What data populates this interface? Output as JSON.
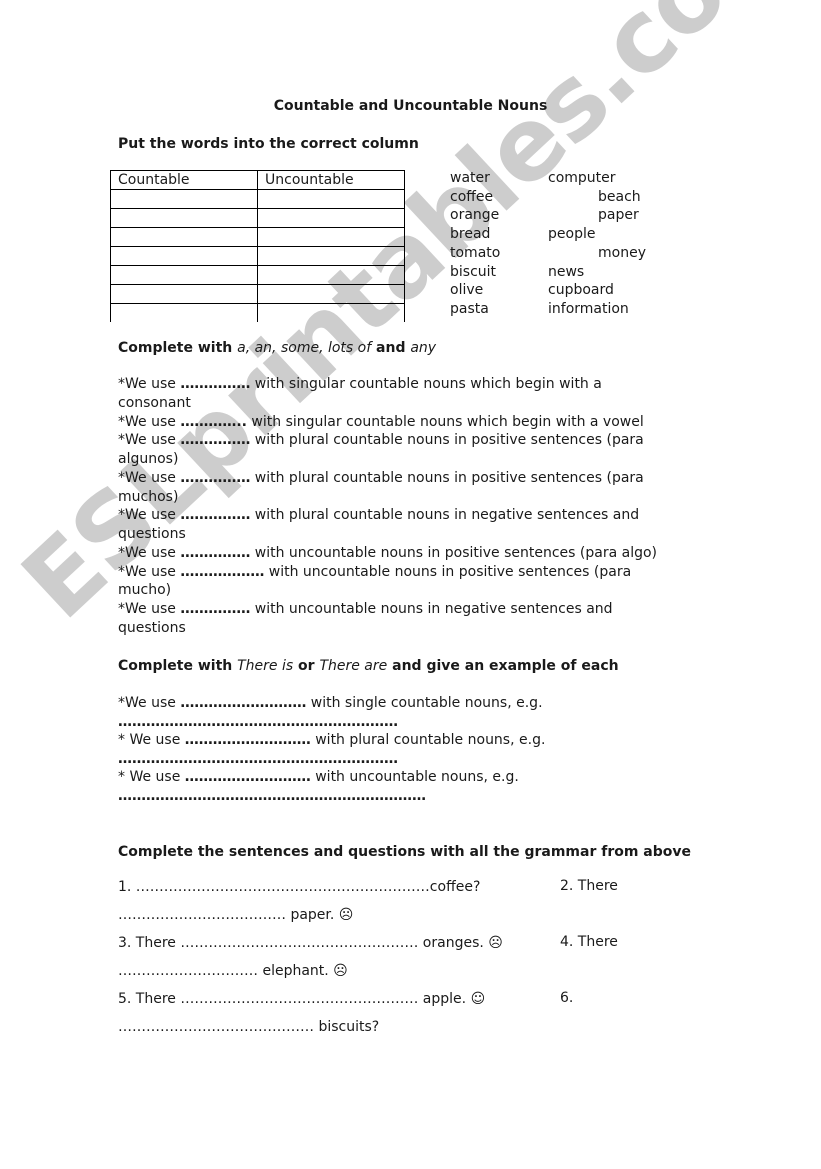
{
  "watermark": "ESLprintables.com",
  "title": "Countable and Uncountable Nouns",
  "section1": {
    "heading": "Put the words into the correct column",
    "table": {
      "headers": [
        "Countable",
        "Uncountable"
      ],
      "empty_rows": 7
    },
    "words_col1": [
      "water",
      "coffee",
      "orange",
      "bread",
      "tomato",
      "biscuit",
      "olive",
      "pasta"
    ],
    "words_col2": [
      "computer",
      "beach",
      "paper",
      "people",
      "money",
      "news",
      "cupboard",
      "information"
    ]
  },
  "section2": {
    "heading_prefix": "Complete with ",
    "heading_words": "a, an, some, lots of",
    "heading_and": " and ",
    "heading_any": "any",
    "lines": [
      {
        "prefix": "*We use ",
        "dots": "……………",
        "text": " with singular countable nouns which begin with a"
      },
      {
        "prefix": "",
        "dots": "",
        "text": "consonant"
      },
      {
        "prefix": "*We use ",
        "dots": "…………..",
        "text": " with singular countable nouns which begin with a vowel"
      },
      {
        "prefix": "*We use ",
        "dots": "……………",
        "text": " with plural countable nouns in positive sentences (para"
      },
      {
        "prefix": "",
        "dots": "",
        "text": "algunos)"
      },
      {
        "prefix": "*We use ",
        "dots": "……………",
        "text": " with plural countable nouns in positive sentences (para"
      },
      {
        "prefix": "",
        "dots": "",
        "text": "muchos)"
      },
      {
        "prefix": "*We use ",
        "dots": "……………",
        "text": " with plural countable nouns in negative sentences and"
      },
      {
        "prefix": "",
        "dots": "",
        "text": "questions"
      },
      {
        "prefix": "*We use ",
        "dots": "……………",
        "text": " with uncountable nouns in positive sentences (para algo)"
      },
      {
        "prefix": "*We use ",
        "dots": "………………",
        "text": " with uncountable nouns in positive sentences (para"
      },
      {
        "prefix": "",
        "dots": "",
        "text": "mucho)"
      },
      {
        "prefix": "*We use ",
        "dots": "……………",
        "text": " with uncountable nouns in negative sentences and"
      },
      {
        "prefix": "",
        "dots": "",
        "text": "questions"
      }
    ]
  },
  "section3": {
    "heading_prefix": "Complete with ",
    "heading_there_is": "There is",
    "heading_or": " or ",
    "heading_there_are": "There are",
    "heading_suffix": " and give an example of each",
    "lines": [
      {
        "prefix": "*We use ",
        "dots": "………………………",
        "text": " with single countable nouns, e.g."
      },
      {
        "prefix": "",
        "dots": "……………………………………………………",
        "text": ""
      },
      {
        "prefix": "* We use ",
        "dots": "………………………",
        "text": " with plural countable nouns, e.g."
      },
      {
        "prefix": "",
        "dots": "……………………………………………………",
        "text": ""
      },
      {
        "prefix": "* We use ",
        "dots": "………………………",
        "text": " with uncountable nouns, e.g."
      },
      {
        "prefix": "",
        "dots": "…………………………………………………………",
        "text": ""
      }
    ]
  },
  "section4": {
    "heading": "Complete the sentences and questions with all the grammar from above",
    "rows": [
      {
        "left": "1. ………………………………………………………coffee?",
        "right": "2. There"
      },
      {
        "left": "……………………………… paper. ☹",
        "right": ""
      },
      {
        "left": "3. There …………………………………………… oranges. ☹",
        "right": "4. There"
      },
      {
        "left": "………………………… elephant. ☹",
        "right": ""
      },
      {
        "left": "5. There …………………………………………… apple. ☺",
        "right": "6."
      },
      {
        "left": "…………………………………… biscuits?",
        "right": ""
      }
    ]
  }
}
